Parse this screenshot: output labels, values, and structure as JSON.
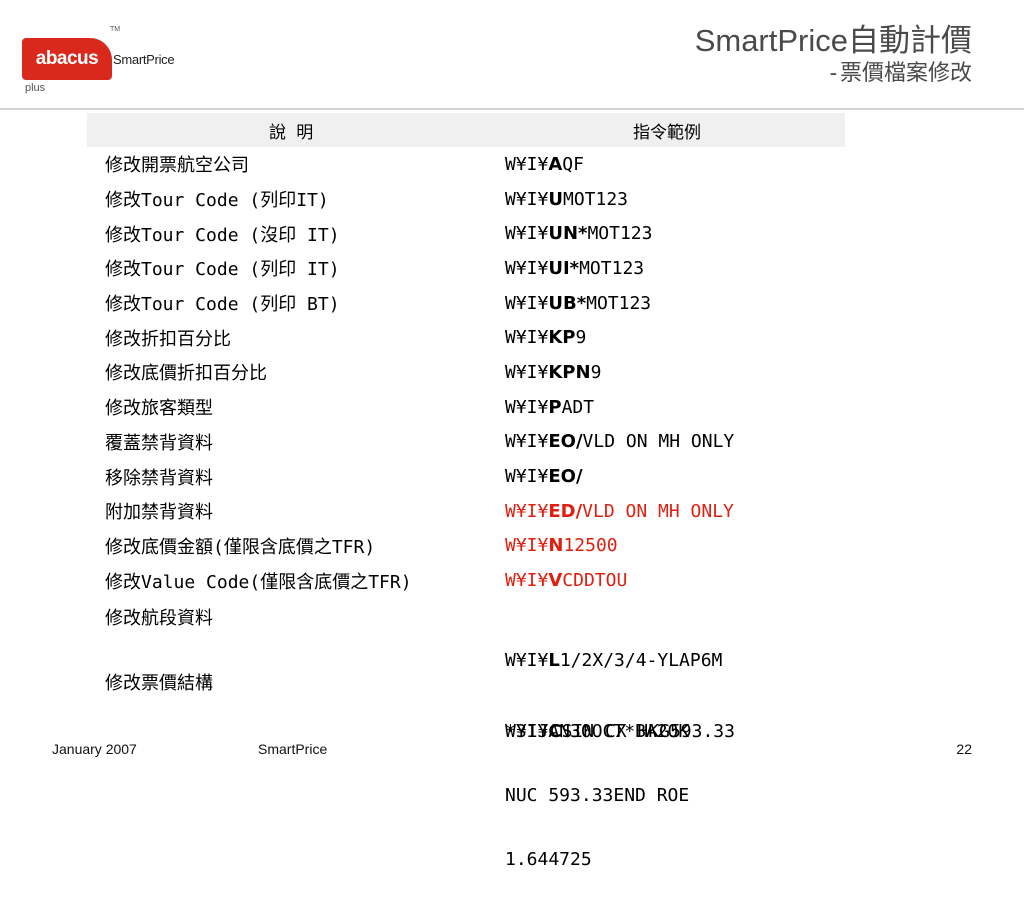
{
  "logo": {
    "brand": "abacus",
    "plus": "plus",
    "tm": "TM",
    "product": "SmartPrice"
  },
  "title": {
    "main": "SmartPrice自動計價",
    "sub": "-票價檔案修改"
  },
  "table": {
    "headers": [
      "說  明",
      "指令範例"
    ],
    "rows": [
      {
        "desc": "修改開票航空公司",
        "prefix": "W¥I¥",
        "bold": "A",
        "rest": "QF"
      },
      {
        "desc": "修改Tour Code (列印IT)",
        "prefix": "W¥I¥",
        "bold": "U",
        "rest": "MOT123"
      },
      {
        "desc": "修改Tour Code (沒印 IT)",
        "prefix": "W¥I¥",
        "bold": "UN*",
        "rest": "MOT123"
      },
      {
        "desc": "修改Tour Code (列印 IT)",
        "prefix": "W¥I¥",
        "bold": "UI*",
        "rest": "MOT123"
      },
      {
        "desc": "修改Tour Code (列印 BT)",
        "prefix": "W¥I¥",
        "bold": "UB*",
        "rest": "MOT123"
      },
      {
        "desc": "修改折扣百分比",
        "prefix": "W¥I¥",
        "bold": "KP",
        "rest": "9"
      },
      {
        "desc": "修改底價折扣百分比",
        "prefix": "W¥I¥",
        "bold": "KPN",
        "rest": "9"
      },
      {
        "desc": "修改旅客類型",
        "prefix": "W¥I¥",
        "bold": "P",
        "rest": "ADT"
      },
      {
        "desc": "覆蓋禁背資料",
        "prefix": "W¥I¥",
        "bold": "EO/",
        "rest": "VLD ON MH ONLY"
      },
      {
        "desc": "移除禁背資料",
        "prefix": "W¥I¥",
        "bold": "EO/",
        "rest": ""
      },
      {
        "desc": "附加禁背資料",
        "prefix": "W¥I¥",
        "bold": "ED/",
        "rest": "VLD ON MH ONLY",
        "red": true
      },
      {
        "desc": "修改底價金額(僅限含底價之TFR)",
        "prefix": "W¥I¥",
        "bold": "N",
        "rest": "12500",
        "red": true
      },
      {
        "desc": "修改Value Code(僅限含底價之TFR)",
        "prefix": "W¥I¥",
        "bold": "V",
        "rest": "CDDTOU",
        "red": true
      }
    ],
    "segment_row": {
      "desc": "修改航段資料",
      "prefix": "W¥I¥",
      "bold": "L",
      "rest": "1/2X/3/4-YLAP6M",
      "line2": "*31JAN30OCT*BA20K"
    },
    "fare_row": {
      "desc": "修改票價結構",
      "prefix": "W¥I¥",
      "bold": "C",
      "rest": "SIN CX HKG593.33",
      "line2": "NUC 593.33END ROE",
      "line3": "1.644725"
    }
  },
  "footer": {
    "date": "January 2007",
    "brand": "SmartPrice",
    "page": "22"
  },
  "colors": {
    "accent_red": "#d8291c",
    "command_red": "#e01f10",
    "header_bg": "#f0f0f0"
  }
}
